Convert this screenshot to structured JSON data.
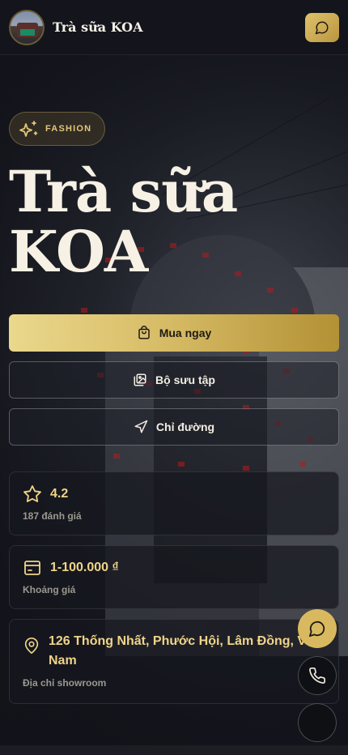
{
  "header": {
    "brand_name": "Trà sữa KOA"
  },
  "hero": {
    "badge_label": "FASHION",
    "title_line1": "Trà sữa",
    "title_line2": "KOA"
  },
  "actions": {
    "buy_label": "Mua ngay",
    "gallery_label": "Bộ sưu tập",
    "directions_label": "Chỉ đường"
  },
  "info": {
    "rating_value": "4.2",
    "rating_caption": "187 đánh giá",
    "price_value": "1-100.000 ₫",
    "price_caption": "Khoảng giá",
    "address_value": "126 Thống Nhất, Phước Hội, Lâm Đồng, Việt Nam",
    "address_caption": "Địa chỉ showroom"
  },
  "colors": {
    "accent_gold": "#d9b95f",
    "background": "#14151b",
    "text_gold": "#efd489"
  },
  "icons": [
    "chat-icon",
    "sparkles-icon",
    "shopping-bag-icon",
    "gallery-icon",
    "navigation-icon",
    "star-icon",
    "wallet-icon",
    "map-pin-icon",
    "phone-icon"
  ]
}
